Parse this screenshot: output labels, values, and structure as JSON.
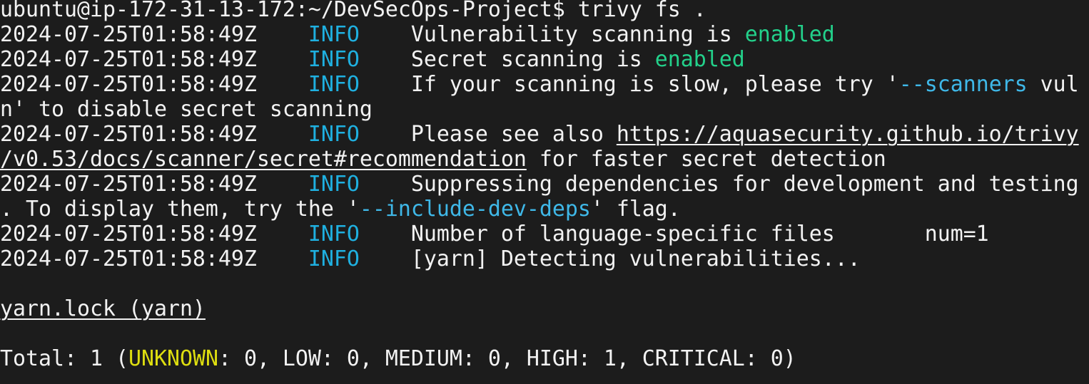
{
  "colors": {
    "background": "#1c1c1c",
    "text": "#f2f2f2",
    "info": "#1fb0e0",
    "enabled": "#23d18b",
    "flag": "#3fb8e8",
    "unknown": "#dede10"
  },
  "terminal": {
    "lines": [
      [
        {
          "t": "ubuntu@ip-172-31-13-172:~/DevSecOps-Project$ trivy fs ."
        }
      ],
      [
        {
          "t": "2024-07-25T01:58:49Z    "
        },
        {
          "t": "INFO",
          "c": "info"
        },
        {
          "t": "    Vulnerability scanning is "
        },
        {
          "t": "enabled",
          "c": "green"
        }
      ],
      [
        {
          "t": "2024-07-25T01:58:49Z    "
        },
        {
          "t": "INFO",
          "c": "info"
        },
        {
          "t": "    Secret scanning is "
        },
        {
          "t": "enabled",
          "c": "green"
        }
      ],
      [
        {
          "t": "2024-07-25T01:58:49Z    "
        },
        {
          "t": "INFO",
          "c": "info"
        },
        {
          "t": "    If your scanning is slow, please try '"
        },
        {
          "t": "--scanners",
          "c": "blue"
        },
        {
          "t": " vul"
        }
      ],
      [
        {
          "t": "n' to disable secret scanning"
        }
      ],
      [
        {
          "t": "2024-07-25T01:58:49Z    "
        },
        {
          "t": "INFO",
          "c": "info"
        },
        {
          "t": "    Please see also "
        },
        {
          "t": "https://aquasecurity.github.io/trivy",
          "c": "link"
        }
      ],
      [
        {
          "t": "/v0.53/docs/scanner/secret#recommendation",
          "c": "link"
        },
        {
          "t": " for faster secret detection"
        }
      ],
      [
        {
          "t": "2024-07-25T01:58:49Z    "
        },
        {
          "t": "INFO",
          "c": "info"
        },
        {
          "t": "    Suppressing dependencies for development and testing"
        }
      ],
      [
        {
          "t": ". To display them, try the '"
        },
        {
          "t": "--include-dev-deps",
          "c": "blue"
        },
        {
          "t": "' flag."
        }
      ],
      [
        {
          "t": "2024-07-25T01:58:49Z    "
        },
        {
          "t": "INFO",
          "c": "info"
        },
        {
          "t": "    Number of language-specific files       num=1"
        }
      ],
      [
        {
          "t": "2024-07-25T01:58:49Z    "
        },
        {
          "t": "INFO",
          "c": "info"
        },
        {
          "t": "    [yarn] Detecting vulnerabilities..."
        }
      ],
      [],
      [
        {
          "t": "yarn.lock (yarn)",
          "c": "link"
        }
      ],
      [],
      [
        {
          "t": "Total: 1 ("
        },
        {
          "t": "UNKNOWN",
          "c": "yellow"
        },
        {
          "t": ": 0, LOW: 0, MEDIUM: 0, HIGH: 1, CRITICAL: 0)"
        }
      ]
    ]
  }
}
